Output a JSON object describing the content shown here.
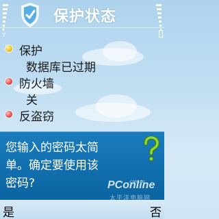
{
  "header": {
    "title": "保护状态",
    "app_icon": "shield-check-icon",
    "signal_icon": "signal-strength-icon",
    "battery_icon": "battery-icon"
  },
  "list": {
    "items": [
      {
        "title": "保护",
        "value": "数据库已过期",
        "status_color": "#f0c020"
      },
      {
        "title": "防火墙",
        "value": "关",
        "status_color": "#e04848"
      },
      {
        "title": "反盗窃",
        "status_color": "#e04848"
      }
    ]
  },
  "dialog": {
    "line1": "您输入的密码太简",
    "line2": "单。确定要使用该",
    "line3": "密码?",
    "icon": "question-mark-icon"
  },
  "softkeys": {
    "left": "是",
    "right": "否"
  },
  "watermark": {
    "brand": "PConline",
    "sub": ".com.cn",
    "chinese": "太平洋电脑网"
  },
  "colors": {
    "dialog_bg": "#0e6fae",
    "title_text": "#ffffff",
    "softkey_bar": "#cfe4f3"
  }
}
